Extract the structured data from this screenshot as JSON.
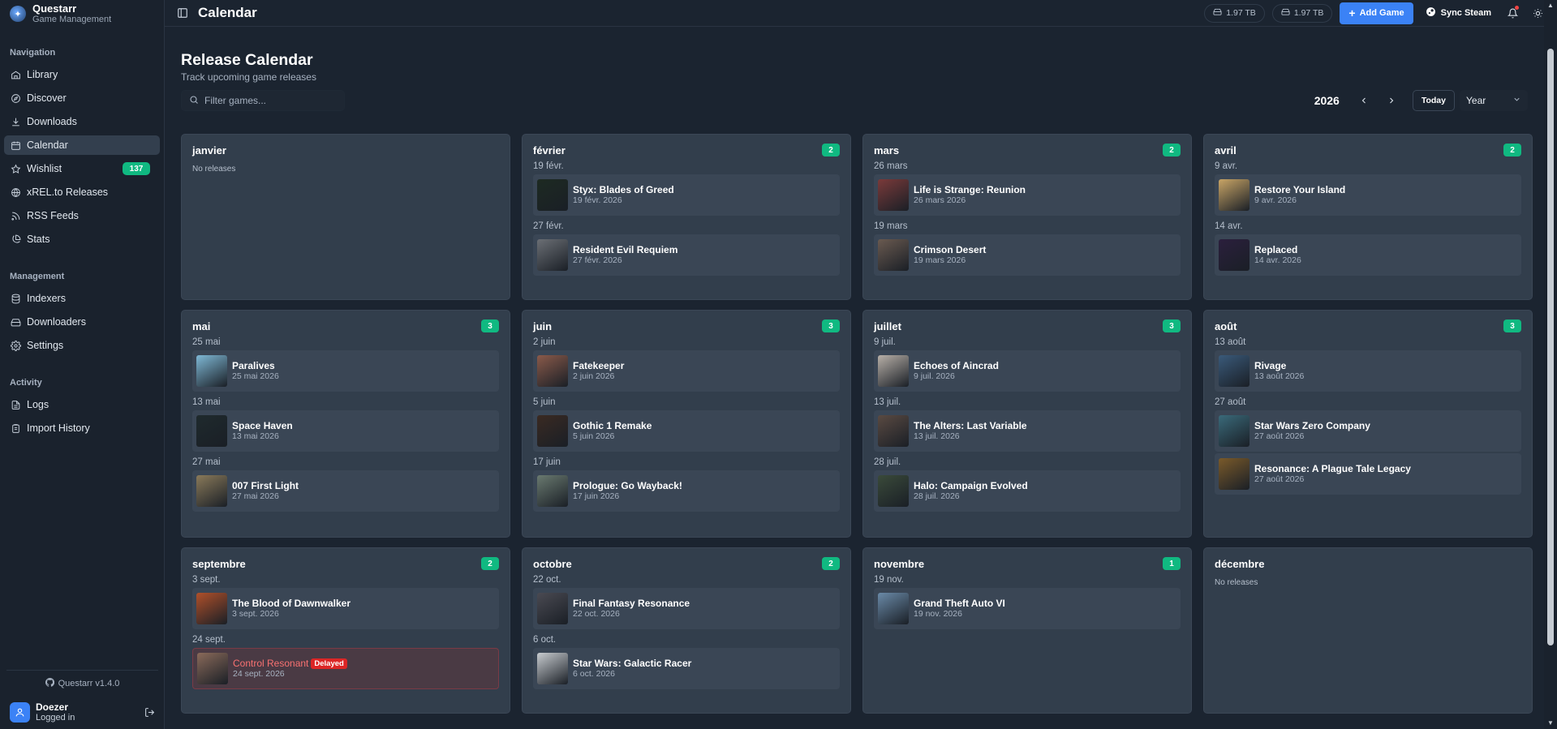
{
  "app": {
    "name": "Questarr",
    "subtitle": "Game Management",
    "version": "Questarr v1.4.0"
  },
  "sidebar": {
    "navigation_heading": "Navigation",
    "navigation": [
      {
        "label": "Library",
        "icon": "library-icon"
      },
      {
        "label": "Discover",
        "icon": "compass-icon"
      },
      {
        "label": "Downloads",
        "icon": "download-icon"
      },
      {
        "label": "Calendar",
        "icon": "calendar-icon",
        "active": true
      },
      {
        "label": "Wishlist",
        "icon": "star-icon",
        "badge": "137"
      },
      {
        "label": "xREL.to Releases",
        "icon": "globe-icon"
      },
      {
        "label": "RSS Feeds",
        "icon": "rss-icon"
      },
      {
        "label": "Stats",
        "icon": "pie-chart-icon"
      }
    ],
    "management_heading": "Management",
    "management": [
      {
        "label": "Indexers",
        "icon": "database-icon"
      },
      {
        "label": "Downloaders",
        "icon": "hard-drive-icon"
      },
      {
        "label": "Settings",
        "icon": "gear-icon"
      }
    ],
    "activity_heading": "Activity",
    "activity": [
      {
        "label": "Logs",
        "icon": "file-text-icon"
      },
      {
        "label": "Import History",
        "icon": "clipboard-icon"
      }
    ],
    "user": {
      "name": "Doezer",
      "status": "Logged in"
    }
  },
  "topbar": {
    "title": "Calendar",
    "storage": [
      "1.97 TB",
      "1.97 TB"
    ],
    "add_game": "Add Game",
    "sync_steam": "Sync Steam"
  },
  "page": {
    "title": "Release Calendar",
    "subtitle": "Track upcoming game releases",
    "filter_placeholder": "Filter games...",
    "year": "2026",
    "today": "Today",
    "view": "Year"
  },
  "months": [
    {
      "name": "janvier",
      "count": "",
      "empty": "No releases",
      "groups": []
    },
    {
      "name": "février",
      "count": "2",
      "groups": [
        {
          "day": "19 févr.",
          "games": [
            {
              "title": "Styx: Blades of Greed",
              "date": "19 févr. 2026",
              "color": "#1d2a22"
            }
          ]
        },
        {
          "day": "27 févr.",
          "games": [
            {
              "title": "Resident Evil Requiem",
              "date": "27 févr. 2026",
              "color": "#6b6f75"
            }
          ]
        }
      ]
    },
    {
      "name": "mars",
      "count": "2",
      "groups": [
        {
          "day": "26 mars",
          "games": [
            {
              "title": "Life is Strange: Reunion",
              "date": "26 mars 2026",
              "color": "#7a3a3a"
            }
          ]
        },
        {
          "day": "19 mars",
          "games": [
            {
              "title": "Crimson Desert",
              "date": "19 mars 2026",
              "color": "#6a5a50"
            }
          ]
        }
      ]
    },
    {
      "name": "avril",
      "count": "2",
      "groups": [
        {
          "day": "9 avr.",
          "games": [
            {
              "title": "Restore Your Island",
              "date": "9 avr. 2026",
              "color": "#c9a566"
            }
          ]
        },
        {
          "day": "14 avr.",
          "games": [
            {
              "title": "Replaced",
              "date": "14 avr. 2026",
              "color": "#2b1f3d"
            }
          ]
        }
      ]
    },
    {
      "name": "mai",
      "count": "3",
      "groups": [
        {
          "day": "25 mai",
          "games": [
            {
              "title": "Paralives",
              "date": "25 mai 2026",
              "color": "#7fb9d6"
            }
          ]
        },
        {
          "day": "13 mai",
          "games": [
            {
              "title": "Space Haven",
              "date": "13 mai 2026",
              "color": "#1f2a2d"
            }
          ]
        },
        {
          "day": "27 mai",
          "games": [
            {
              "title": "007 First Light",
              "date": "27 mai 2026",
              "color": "#8a7a5a"
            }
          ]
        }
      ]
    },
    {
      "name": "juin",
      "count": "3",
      "groups": [
        {
          "day": "2 juin",
          "games": [
            {
              "title": "Fatekeeper",
              "date": "2 juin 2026",
              "color": "#8a5a4a"
            }
          ]
        },
        {
          "day": "5 juin",
          "games": [
            {
              "title": "Gothic 1 Remake",
              "date": "5 juin 2026",
              "color": "#3a2a22"
            }
          ]
        },
        {
          "day": "17 juin",
          "games": [
            {
              "title": "Prologue: Go Wayback!",
              "date": "17 juin 2026",
              "color": "#6a7a70"
            }
          ]
        }
      ]
    },
    {
      "name": "juillet",
      "count": "3",
      "groups": [
        {
          "day": "9 juil.",
          "games": [
            {
              "title": "Echoes of Aincrad",
              "date": "9 juil. 2026",
              "color": "#b8b0a8"
            }
          ]
        },
        {
          "day": "13 juil.",
          "games": [
            {
              "title": "The Alters: Last Variable",
              "date": "13 juil. 2026",
              "color": "#5a4a42"
            }
          ]
        },
        {
          "day": "28 juil.",
          "games": [
            {
              "title": "Halo: Campaign Evolved",
              "date": "28 juil. 2026",
              "color": "#3a4a3a"
            }
          ]
        }
      ]
    },
    {
      "name": "août",
      "count": "3",
      "groups": [
        {
          "day": "13 août",
          "games": [
            {
              "title": "Rivage",
              "date": "13 août 2026",
              "color": "#3a5a7a"
            }
          ]
        },
        {
          "day": "27 août",
          "games": [
            {
              "title": "Star Wars Zero Company",
              "date": "27 août 2026",
              "color": "#3a6a7a"
            },
            {
              "title": "Resonance: A Plague Tale Legacy",
              "date": "27 août 2026",
              "color": "#7a5a2a"
            }
          ]
        }
      ]
    },
    {
      "name": "septembre",
      "count": "2",
      "groups": [
        {
          "day": "3 sept.",
          "games": [
            {
              "title": "The Blood of Dawnwalker",
              "date": "3 sept. 2026",
              "color": "#b0502a"
            }
          ]
        },
        {
          "day": "24 sept.",
          "games": [
            {
              "title": "Control Resonant",
              "date": "24 sept. 2026",
              "color": "#8a6a5a",
              "delayed": true,
              "delayed_label": "Delayed"
            }
          ]
        }
      ]
    },
    {
      "name": "octobre",
      "count": "2",
      "groups": [
        {
          "day": "22 oct.",
          "games": [
            {
              "title": "Final Fantasy Resonance",
              "date": "22 oct. 2026",
              "color": "#4a4a52"
            }
          ]
        },
        {
          "day": "6 oct.",
          "games": [
            {
              "title": "Star Wars: Galactic Racer",
              "date": "6 oct. 2026",
              "color": "#c8ccd0"
            }
          ]
        }
      ]
    },
    {
      "name": "novembre",
      "count": "1",
      "groups": [
        {
          "day": "19 nov.",
          "games": [
            {
              "title": "Grand Theft Auto VI",
              "date": "19 nov. 2026",
              "color": "#6a8aa8"
            }
          ]
        }
      ]
    },
    {
      "name": "décembre",
      "count": "",
      "empty": "No releases",
      "groups": []
    }
  ]
}
